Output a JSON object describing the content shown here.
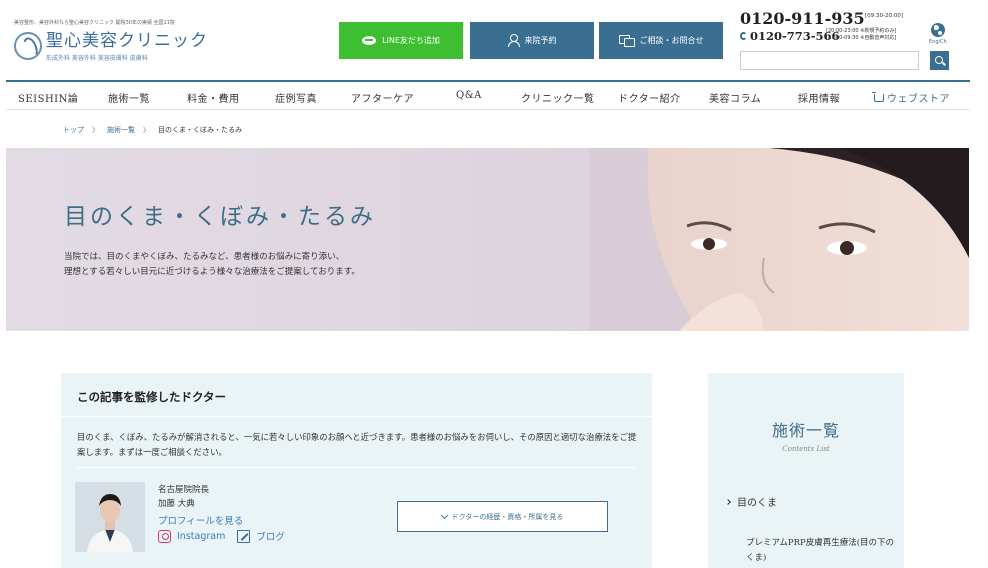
{
  "header": {
    "tagline": "美容整形、美容外科なら聖心美容クリニック 開院30年の実績 全国11院",
    "logo_name": "聖心美容クリニック",
    "logo_sub": "形成外科 美容外科 美容皮膚科 皮膚科",
    "line_button": "LINE友だち追加",
    "visit_button": "来院予約",
    "consult_button": "ご相談・お問合せ",
    "phone_main": "0120-911-935",
    "phone_main_hours": "[09:30-20:00]",
    "phone_sub": "0120-773-566",
    "phone_sub_hours_1": "[20:00-23:00 ※新規予約のみ]",
    "phone_sub_hours_2": "[23:00-09:30 ※自動音声対応]",
    "search_placeholder": "",
    "lang_label": "Eng/Ch"
  },
  "nav": {
    "items": [
      "SEISHIN論",
      "施術一覧",
      "料金・費用",
      "症例写真",
      "アフターケア",
      "Q&A",
      "クリニック一覧",
      "ドクター紹介",
      "美容コラム",
      "採用情報"
    ],
    "store": "ウェブストア"
  },
  "breadcrumb": {
    "home": "トップ",
    "sep": "〉",
    "list": "施術一覧",
    "current": "目のくま・くぼみ・たるみ"
  },
  "hero": {
    "title": "目のくま・くぼみ・たるみ",
    "desc_line1": "当院では、目のくまやくぼみ、たるみなど、患者様のお悩みに寄り添い、",
    "desc_line2": "理想とする若々しい目元に近づけるよう様々な治療法をご提案しております。"
  },
  "doctor_card": {
    "heading": "この記事を監修したドクター",
    "text": "目のくま、くぼみ、たるみが解消されると、一気に若々しい印象のお顔へと近づきます。患者様のお悩みをお伺いし、その原因と適切な治療法をご提案します。まずは一度ご相談ください。",
    "clinic": "名古屋院院長",
    "name": "加藤 大典",
    "profile_link": "プロフィールを見る",
    "instagram": "Instagram",
    "blog": "ブログ",
    "career_button": "ドクターの経歴・資格・所属を見る"
  },
  "sidebar": {
    "title": "施術一覧",
    "subtitle": "Contents List",
    "category": "目のくま",
    "item": "プレミアムPRP皮膚再生療法(目の下のくま)"
  },
  "colors": {
    "brand": "#3b6f92",
    "line_green": "#3dbf31",
    "card_bg": "#eaf3f5",
    "hero_title": "#3f6d88"
  }
}
